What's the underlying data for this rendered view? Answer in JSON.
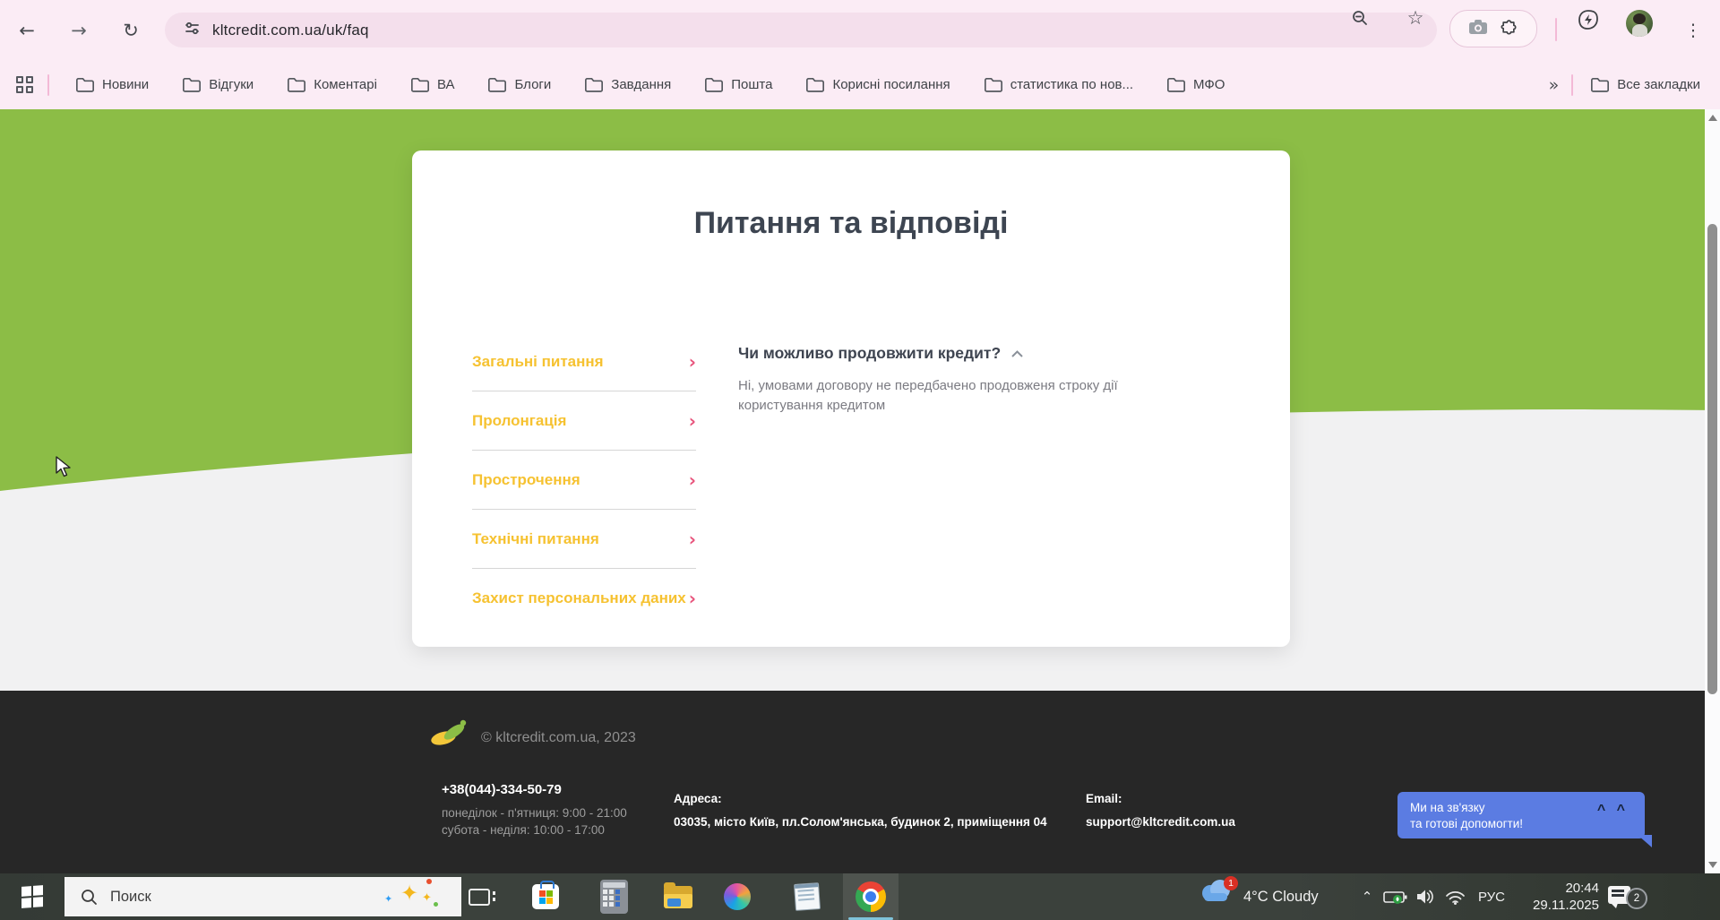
{
  "browser": {
    "url": "kltcredit.com.ua/uk/faq",
    "bookmarks": [
      "Новини",
      "Відгуки",
      "Коментарі",
      "ВА",
      "Блоги",
      "Завдання",
      "Пошта",
      "Корисні посилання",
      "статистика по нов...",
      "МФО"
    ],
    "overflow_chevron": "»",
    "all_bookmarks": "Все закладки"
  },
  "icons": {
    "back": "←",
    "forward": "→",
    "reload": "↻",
    "star": "☆",
    "more": "⋮",
    "sparkle": "✦",
    "tray_chevron": "⌃"
  },
  "page": {
    "title": "Питання та відповіді",
    "chevron_char": "›",
    "menu": [
      {
        "label": "Загальні питання"
      },
      {
        "label": "Пролонгація"
      },
      {
        "label": "Прострочення"
      },
      {
        "label": "Технічні питання"
      },
      {
        "label": "Захист персональних даних"
      }
    ],
    "qa": {
      "question": "Чи можливо продовжити кредит?",
      "answer": "Ні, умовами договору не передбачено продовженя строку дії користування кредитом"
    }
  },
  "footer": {
    "copyright": "© kltcredit.com.ua, 2023",
    "phone": "+38(044)-334-50-79",
    "hours_line1": "понеділок - п'ятниця: 9:00 - 21:00",
    "hours_line2": "субота - неділя: 10:00 - 17:00",
    "address_label": "Адреса:",
    "address": "03035, місто Київ, пл.Солом'янська, будинок 2, приміщення 04",
    "email_label": "Email:",
    "email": "support@kltcredit.com.ua",
    "chat": {
      "line1": "Ми на зв'язку",
      "line2": "та готові допомогти!",
      "eyes": "^ ^"
    }
  },
  "taskbar": {
    "search_placeholder": "Поиск",
    "weather": "4°C  Cloudy",
    "weather_badge": "1",
    "language": "РУС",
    "time": "20:44",
    "date": "29.11.2025",
    "notification_count": "2"
  },
  "colors": {
    "brand_green": "#8cbd46",
    "link_yellow": "#f6c231",
    "chevron_pink": "#e8547c",
    "chat_blue": "#5b7ce2",
    "footer_bg": "#272727",
    "chrome_pink": "#fbecf5"
  }
}
